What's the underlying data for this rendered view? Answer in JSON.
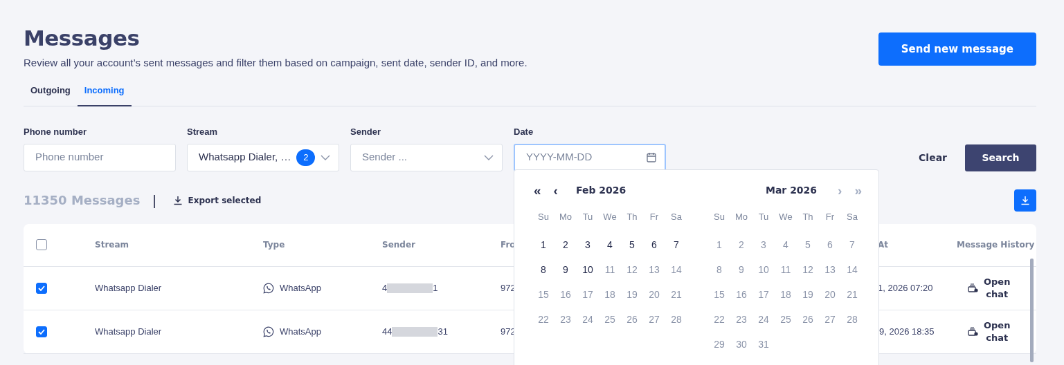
{
  "page": {
    "title": "Messages",
    "subtitle": "Review all your account’s sent messages and filter them based on campaign, sent date, sender ID, and more.",
    "primary_button": "Send new message"
  },
  "tabs": [
    {
      "label": "Outgoing",
      "selected": false
    },
    {
      "label": "Incoming",
      "selected": true
    }
  ],
  "filters": [
    {
      "kind": "text",
      "label": "Phone number",
      "placeholder": "Phone number"
    },
    {
      "kind": "select",
      "label": "Stream",
      "value": "Whatsapp Dialer, …",
      "count": "2"
    },
    {
      "kind": "select",
      "label": "Sender",
      "placeholder": "Sender ..."
    },
    {
      "kind": "date",
      "label": "Date",
      "placeholder": "YYYY-MM-DD",
      "focused": true
    }
  ],
  "clear_button": "Clear",
  "search_button": "Search",
  "summary": {
    "count": "11350 Messages",
    "separator": "|",
    "export": "Export selected"
  },
  "table": {
    "all_checked": false,
    "columns": [
      "Stream",
      "Type",
      "Sender",
      "Fro",
      "At",
      "Message History"
    ],
    "rows": [
      {
        "checked": true,
        "stream": "Whatsapp Dialer",
        "type": "WhatsApp",
        "sender_start": "4",
        "sender_end": "1",
        "from": "972",
        "sent_at": "1, 2026 07:20",
        "action": "Open chat"
      },
      {
        "checked": true,
        "stream": "Whatsapp Dialer",
        "type": "WhatsApp",
        "sender_start": "44",
        "sender_end": "31",
        "from": "972",
        "sent_at": "9, 2026 18:35",
        "action": "Open chat"
      }
    ]
  },
  "date_picker": {
    "nav_left": [
      {
        "label": "«",
        "disabled": false
      },
      {
        "label": "‹",
        "disabled": false
      }
    ],
    "nav_right": [
      {
        "label": "›",
        "disabled": true
      },
      {
        "label": "»",
        "disabled": true
      }
    ],
    "months": [
      {
        "title": "Feb 2026",
        "weekdays": [
          "Su",
          "Mo",
          "Tu",
          "We",
          "Th",
          "Fr",
          "Sa"
        ],
        "days": [
          {
            "label": "1",
            "disabled": false
          },
          {
            "label": "2",
            "disabled": false
          },
          {
            "label": "3",
            "disabled": false
          },
          {
            "label": "4",
            "disabled": false
          },
          {
            "label": "5",
            "disabled": false
          },
          {
            "label": "6",
            "disabled": false
          },
          {
            "label": "7",
            "disabled": false
          },
          {
            "label": "8",
            "disabled": false
          },
          {
            "label": "9",
            "disabled": false
          },
          {
            "label": "10",
            "disabled": false
          },
          {
            "label": "11",
            "disabled": true
          },
          {
            "label": "12",
            "disabled": true
          },
          {
            "label": "13",
            "disabled": true
          },
          {
            "label": "14",
            "disabled": true
          },
          {
            "label": "15",
            "disabled": true
          },
          {
            "label": "16",
            "disabled": true
          },
          {
            "label": "17",
            "disabled": true
          },
          {
            "label": "18",
            "disabled": true
          },
          {
            "label": "19",
            "disabled": true
          },
          {
            "label": "20",
            "disabled": true
          },
          {
            "label": "21",
            "disabled": true
          },
          {
            "label": "22",
            "disabled": true
          },
          {
            "label": "23",
            "disabled": true
          },
          {
            "label": "24",
            "disabled": true
          },
          {
            "label": "25",
            "disabled": true
          },
          {
            "label": "26",
            "disabled": true
          },
          {
            "label": "27",
            "disabled": true
          },
          {
            "label": "28",
            "disabled": true
          }
        ]
      },
      {
        "title": "Mar 2026",
        "weekdays": [
          "Su",
          "Mo",
          "Tu",
          "We",
          "Th",
          "Fr",
          "Sa"
        ],
        "days": [
          {
            "label": "1",
            "disabled": true
          },
          {
            "label": "2",
            "disabled": true
          },
          {
            "label": "3",
            "disabled": true
          },
          {
            "label": "4",
            "disabled": true
          },
          {
            "label": "5",
            "disabled": true
          },
          {
            "label": "6",
            "disabled": true
          },
          {
            "label": "7",
            "disabled": true
          },
          {
            "label": "8",
            "disabled": true
          },
          {
            "label": "9",
            "disabled": true
          },
          {
            "label": "10",
            "disabled": true
          },
          {
            "label": "11",
            "disabled": true
          },
          {
            "label": "12",
            "disabled": true
          },
          {
            "label": "13",
            "disabled": true
          },
          {
            "label": "14",
            "disabled": true
          },
          {
            "label": "15",
            "disabled": true
          },
          {
            "label": "16",
            "disabled": true
          },
          {
            "label": "17",
            "disabled": true
          },
          {
            "label": "18",
            "disabled": true
          },
          {
            "label": "19",
            "disabled": true
          },
          {
            "label": "20",
            "disabled": true
          },
          {
            "label": "21",
            "disabled": true
          },
          {
            "label": "22",
            "disabled": true
          },
          {
            "label": "23",
            "disabled": true
          },
          {
            "label": "24",
            "disabled": true
          },
          {
            "label": "25",
            "disabled": true
          },
          {
            "label": "26",
            "disabled": true
          },
          {
            "label": "27",
            "disabled": true
          },
          {
            "label": "28",
            "disabled": true
          },
          {
            "label": "29",
            "disabled": true
          },
          {
            "label": "30",
            "disabled": true
          },
          {
            "label": "31",
            "disabled": true
          }
        ]
      }
    ]
  }
}
